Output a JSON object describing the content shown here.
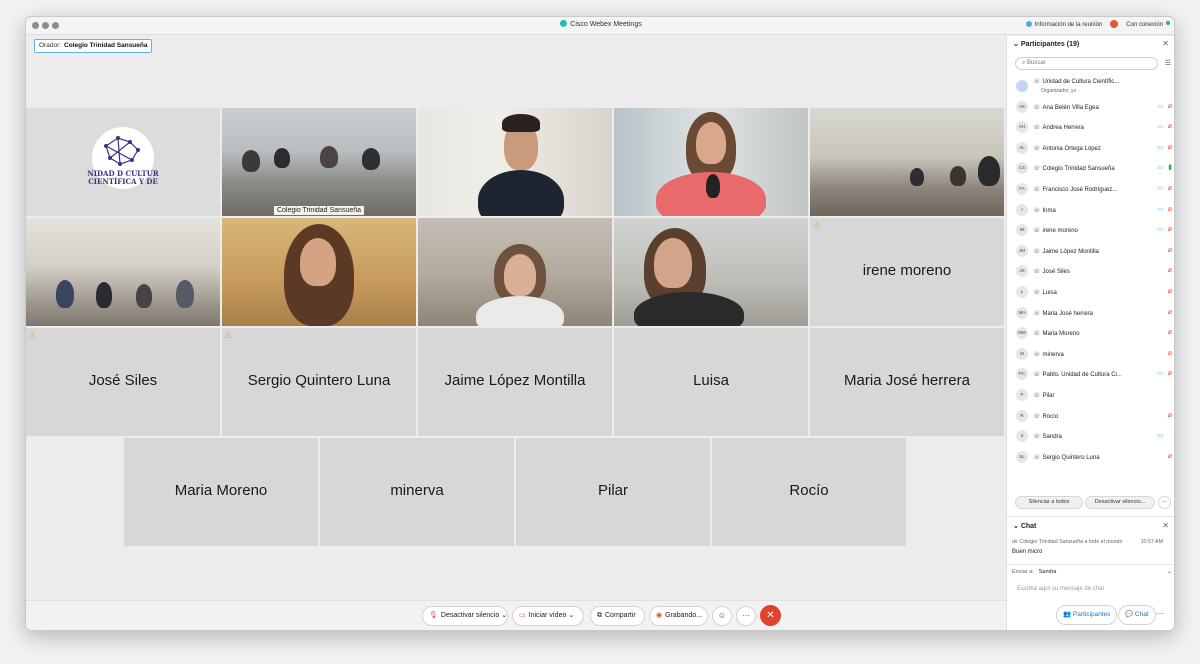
{
  "window": {
    "title": "Cisco Webex Meetings",
    "info_label": "Información de la reunión",
    "status": "Con conexión"
  },
  "speaker": {
    "label": "Orador:",
    "name": "Colegio Trinidad Sansueña"
  },
  "logo_text": [
    "NIDAD D CULTUR",
    "CIENTÍFICA Y DE"
  ],
  "video_caption": "Colegio Trinidad Sansueña",
  "name_tiles": {
    "irene": "irene moreno",
    "jose": "José Siles",
    "sergio": "Sergio Quintero Luna",
    "jaime": "Jaime López Montilla",
    "luisa": "Luisa",
    "maria_jose": "Maria José herrera",
    "maria_moreno": "Maria Moreno",
    "minerva": "minerva",
    "pilar": "Pilar",
    "rocio": "Rocío"
  },
  "toolbar": {
    "unmute": "Desactivar silencio",
    "start_video": "Iniciar vídeo",
    "share": "Compartir",
    "recording": "Grabando...",
    "participants": "Participantes",
    "chat": "Chat"
  },
  "participants": {
    "title": "Participantes (19)",
    "search_placeholder": "Buscar",
    "mute_all": "Silenciar a todos",
    "unmute_all": "Desactivar silencio...",
    "items": [
      {
        "initials": "",
        "name": "Unidad de Cultura Científic...",
        "sub": "Organizador, yo",
        "cam": false,
        "mic": ""
      },
      {
        "initials": "AE",
        "name": "Ana Belén Villa Egea",
        "cam": true,
        "mic": "off"
      },
      {
        "initials": "AH",
        "name": "Andrea Herrera",
        "cam": true,
        "mic": "off"
      },
      {
        "initials": "AL",
        "name": "Antonia Ortega López",
        "cam": true,
        "mic": "off"
      },
      {
        "initials": "CS",
        "name": "Colegio Trinidad Sansueña",
        "cam": true,
        "mic": "on"
      },
      {
        "initials": "FA",
        "name": "Francisco José Rodríguez...",
        "cam": true,
        "mic": "off"
      },
      {
        "initials": "I",
        "name": "Inma",
        "cam": true,
        "mic": "off"
      },
      {
        "initials": "IM",
        "name": "irene moreno",
        "cam": true,
        "mic": "off"
      },
      {
        "initials": "JM",
        "name": "Jaime López Montilla",
        "cam": false,
        "mic": "off"
      },
      {
        "initials": "JS",
        "name": "José Siles",
        "cam": false,
        "mic": "off"
      },
      {
        "initials": "L",
        "name": "Luisa",
        "cam": false,
        "mic": "off"
      },
      {
        "initials": "MH",
        "name": "Maria José herrera",
        "cam": false,
        "mic": "off"
      },
      {
        "initials": "MM",
        "name": "Maria Moreno",
        "cam": false,
        "mic": "off"
      },
      {
        "initials": "M",
        "name": "minerva",
        "cam": false,
        "mic": "off"
      },
      {
        "initials": "PC",
        "name": "Pablo. Unidad de Cultura Ci...",
        "cam": true,
        "mic": "off"
      },
      {
        "initials": "P",
        "name": "Pilar",
        "cam": false,
        "mic": ""
      },
      {
        "initials": "R",
        "name": "Rocío",
        "cam": false,
        "mic": "off"
      },
      {
        "initials": "S",
        "name": "Sandra",
        "cam": true,
        "mic": ""
      },
      {
        "initials": "SL",
        "name": "Sergio Quintero Luna",
        "cam": false,
        "mic": "off"
      }
    ]
  },
  "chat": {
    "title": "Chat",
    "meta": "de Colegio Trinidad Sansueña a todo el mundo",
    "time": "10:57 AM",
    "message": "Buen micro",
    "send_label": "Enviar a:",
    "send_to": "Sandra",
    "input_placeholder": "Escriba aquí su mensaje de chat"
  }
}
